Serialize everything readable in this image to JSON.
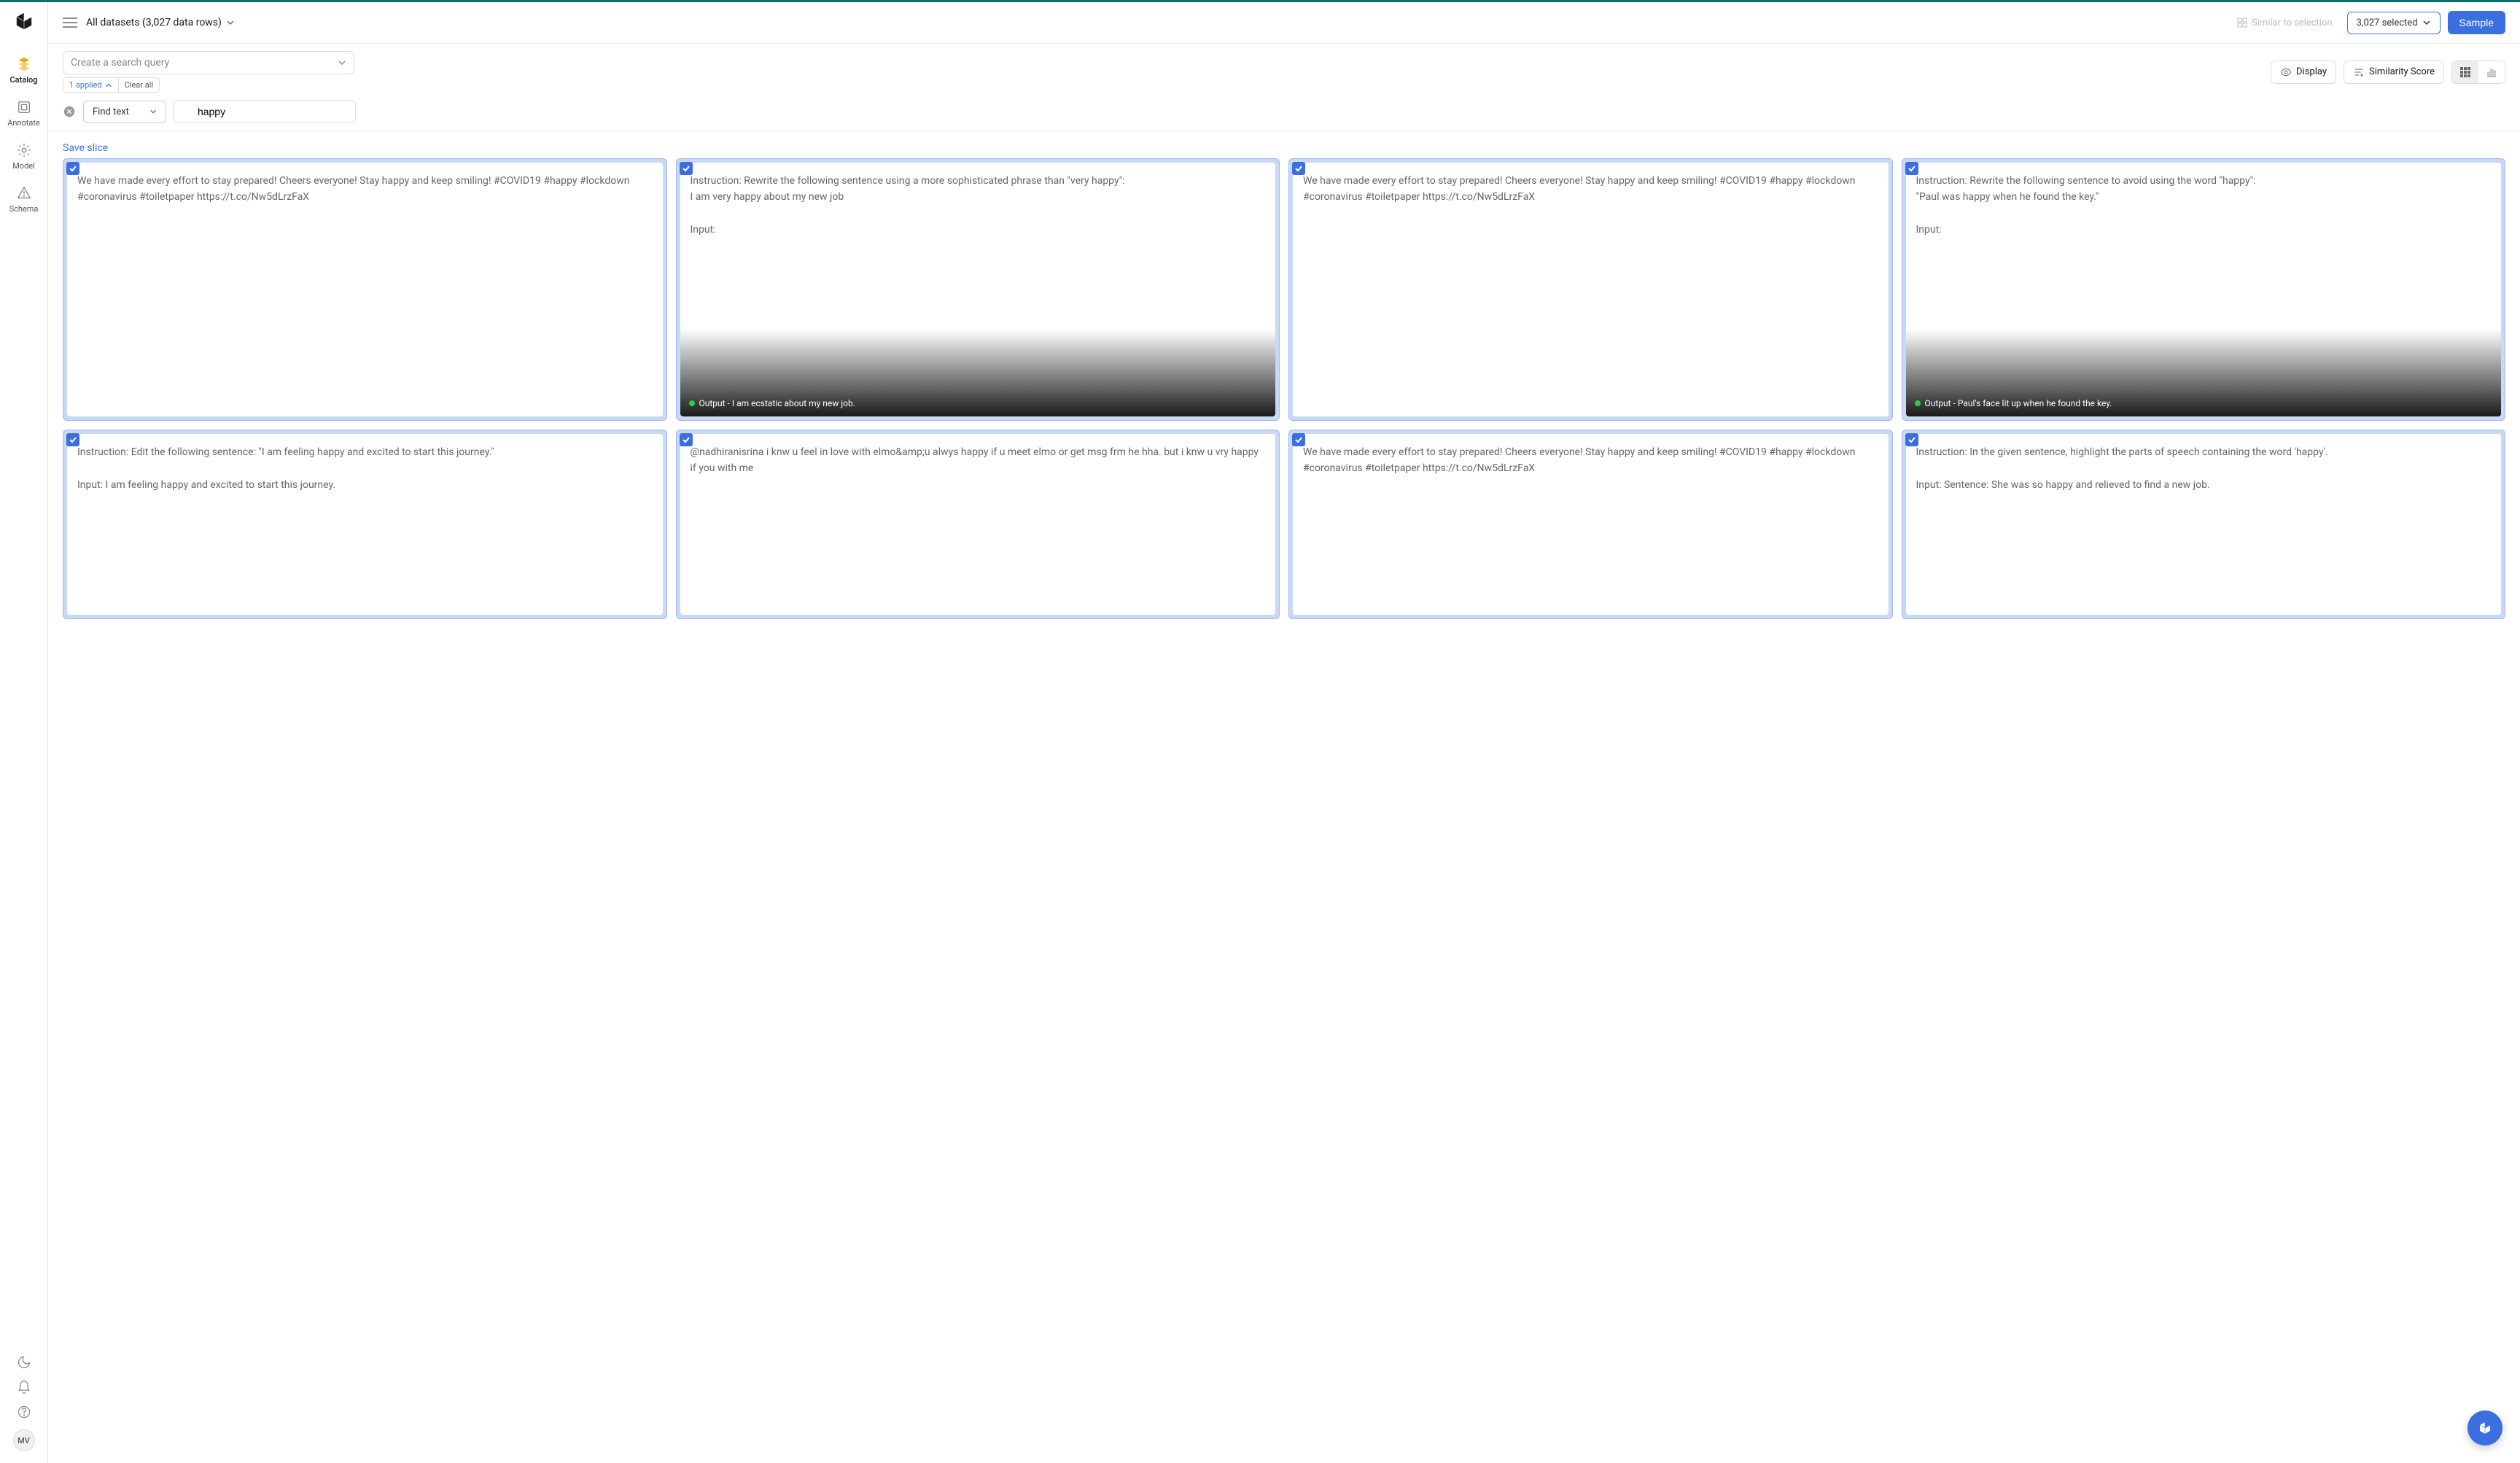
{
  "sidebar": {
    "items": [
      {
        "label": "Catalog"
      },
      {
        "label": "Annotate"
      },
      {
        "label": "Model"
      },
      {
        "label": "Schema"
      }
    ],
    "avatar": "MV"
  },
  "topbar": {
    "dataset_label": "All datasets (3,027 data rows)",
    "similar_label": "Similar to selection",
    "selected_label": "3,027 selected",
    "sample_label": "Sample"
  },
  "filterbar": {
    "search_placeholder": "Create a search query",
    "applied_label": "1 applied",
    "clear_all_label": "Clear all",
    "display_label": "Display",
    "similarity_label": "Similarity Score",
    "find_text_label": "Find text",
    "text_search_value": "happy"
  },
  "save_slice_label": "Save slice",
  "cards": [
    {
      "text": "We have made every effort to stay prepared! Cheers everyone! Stay happy and keep smiling! #COVID19 #happy #lockdown #coronavirus #toiletpaper https://t.co/Nw5dLrzFaX",
      "fade": "light"
    },
    {
      "text": "Instruction: Rewrite the following sentence using a more sophisticated phrase than \"very happy\":\nI am very happy about my new job\n\nInput:",
      "fade": "dark",
      "output": "Output - I am ecstatic about my new job."
    },
    {
      "text": "We have made every effort to stay prepared! Cheers everyone! Stay happy and keep smiling! #COVID19 #happy #lockdown #coronavirus #toiletpaper https://t.co/Nw5dLrzFaX",
      "fade": "light"
    },
    {
      "text": "Instruction: Rewrite the following sentence to avoid using the word \"happy\":\n\"Paul was happy when he found the key.\"\n\nInput:",
      "fade": "dark",
      "output": "Output - Paul's face lit up when he found the key."
    },
    {
      "text": "Instruction: Edit the following sentence: \"I am feeling happy and excited to start this journey.\"\n\nInput: I am feeling happy and excited to start this journey.",
      "fade": "light",
      "short": true
    },
    {
      "text": "@nadhiranisrina i knw u feel in love with elmo&amp;u alwys happy if u meet elmo or get msg frm he hha. but i knw u vry happy if you with me",
      "fade": "light",
      "short": true
    },
    {
      "text": "We have made every effort to stay prepared! Cheers everyone! Stay happy and keep smiling! #COVID19 #happy #lockdown #coronavirus #toiletpaper https://t.co/Nw5dLrzFaX",
      "fade": "light",
      "short": true
    },
    {
      "text": "Instruction: In the given sentence, highlight the parts of speech containing the word 'happy'.\n\nInput: Sentence: She was so happy and relieved to find a new job.",
      "fade": "light",
      "short": true
    }
  ]
}
